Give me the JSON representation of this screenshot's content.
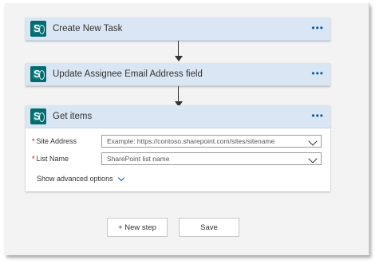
{
  "flow": {
    "steps": [
      {
        "title": "Create New Task",
        "icon": "sharepoint-icon",
        "icon_letter": "S",
        "more": "•••"
      },
      {
        "title": "Update Assignee Email Address field",
        "icon": "sharepoint-icon",
        "icon_letter": "S",
        "more": "•••"
      },
      {
        "title": "Get items",
        "icon": "sharepoint-icon",
        "icon_letter": "S",
        "more": "•••",
        "fields": [
          {
            "required_mark": "*",
            "label": "Site Address",
            "placeholder": "Example: https://contoso.sharepoint.com/sites/sitename",
            "value": ""
          },
          {
            "required_mark": "*",
            "label": "List Name",
            "placeholder": "SharePoint list name",
            "value": ""
          }
        ],
        "advanced_label": "Show advanced options"
      }
    ]
  },
  "footer": {
    "new_step_label": "+ New step",
    "save_label": "Save"
  },
  "colors": {
    "header_bg": "#dbe6f4",
    "accent": "#0062ad",
    "sharepoint": "#036c70",
    "required": "#c00000"
  }
}
